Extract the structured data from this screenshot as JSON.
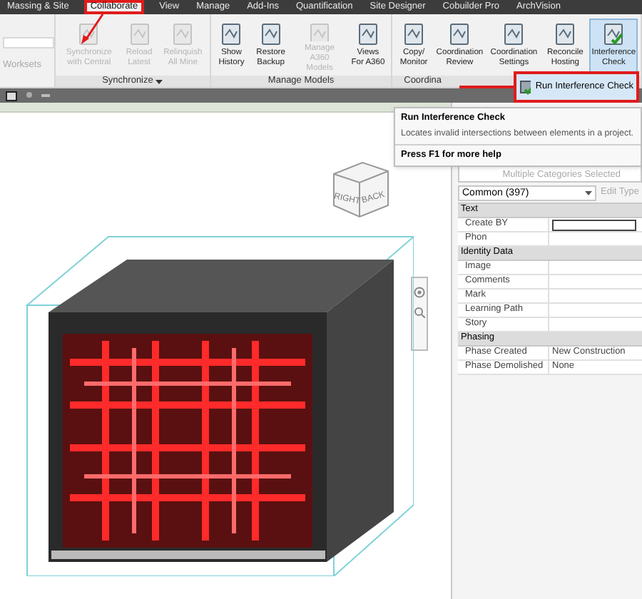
{
  "menu_tabs": [
    {
      "label": "Massing & Site",
      "selected": false
    },
    {
      "label": "Collaborate",
      "selected": true
    },
    {
      "label": "View",
      "selected": false
    },
    {
      "label": "Manage",
      "selected": false
    },
    {
      "label": "Add-Ins",
      "selected": false
    },
    {
      "label": "Quantification",
      "selected": false
    },
    {
      "label": "Site Designer",
      "selected": false
    },
    {
      "label": "Cobuilder Pro",
      "selected": false
    },
    {
      "label": "ArchVision",
      "selected": false
    }
  ],
  "ribbon": {
    "worksets_label": "Worksets",
    "panels": [
      {
        "label": "Synchronize",
        "has_menu": true,
        "buttons": [
          {
            "label": "Synchronize with Central",
            "disabled": true,
            "selected": false
          },
          {
            "label": "Reload Latest",
            "disabled": true,
            "selected": false
          },
          {
            "label": "Relinquish All Mine",
            "disabled": true,
            "selected": false
          }
        ]
      },
      {
        "label": "Manage Models",
        "buttons": [
          {
            "label": "Show History",
            "disabled": false,
            "selected": false
          },
          {
            "label": "Restore Backup",
            "disabled": false,
            "selected": false
          },
          {
            "label": "Manage A360 Models",
            "disabled": true,
            "selected": false
          },
          {
            "label": "Views For A360",
            "disabled": false,
            "selected": false
          }
        ]
      },
      {
        "label": "Coordina",
        "buttons": [
          {
            "label": "Copy/ Monitor",
            "disabled": false,
            "selected": false
          },
          {
            "label": "Coordination Review",
            "disabled": false,
            "selected": false
          },
          {
            "label": "Coordination Settings",
            "disabled": false,
            "selected": false
          },
          {
            "label": "Reconcile Hosting",
            "disabled": false,
            "selected": false
          },
          {
            "label": "Interference Check",
            "disabled": false,
            "selected": true
          }
        ]
      }
    ]
  },
  "dropdown": {
    "items": [
      {
        "label": "Run Interference Check",
        "selected": true
      }
    ]
  },
  "tooltip": {
    "title": "Run Interference Check",
    "description": "Locates invalid intersections between elements in a project.",
    "help": "Press F1 for more help"
  },
  "view_cube": {
    "faces": [
      "RIGHT",
      "BACK"
    ]
  },
  "properties": {
    "selection": "Multiple Categories Selected",
    "type_selector": "Common (397)",
    "edit_type": "Edit Type",
    "groups": [
      {
        "name": "Text",
        "rows": [
          {
            "name": "Create BY",
            "kind": "input"
          },
          {
            "name": "Phon",
            "kind": "text"
          }
        ]
      },
      {
        "name": "Identity Data",
        "rows": [
          {
            "name": "Image",
            "kind": "text"
          },
          {
            "name": "Comments",
            "kind": "text"
          },
          {
            "name": "Mark",
            "kind": "text"
          },
          {
            "name": "Learning Path",
            "kind": "text"
          },
          {
            "name": "Story",
            "kind": "text"
          }
        ]
      },
      {
        "name": "Phasing",
        "rows": [
          {
            "name": "Phase Created",
            "kind": "text",
            "value": "New Construction"
          },
          {
            "name": "Phase Demolished",
            "kind": "text",
            "value": "None"
          }
        ]
      }
    ]
  }
}
